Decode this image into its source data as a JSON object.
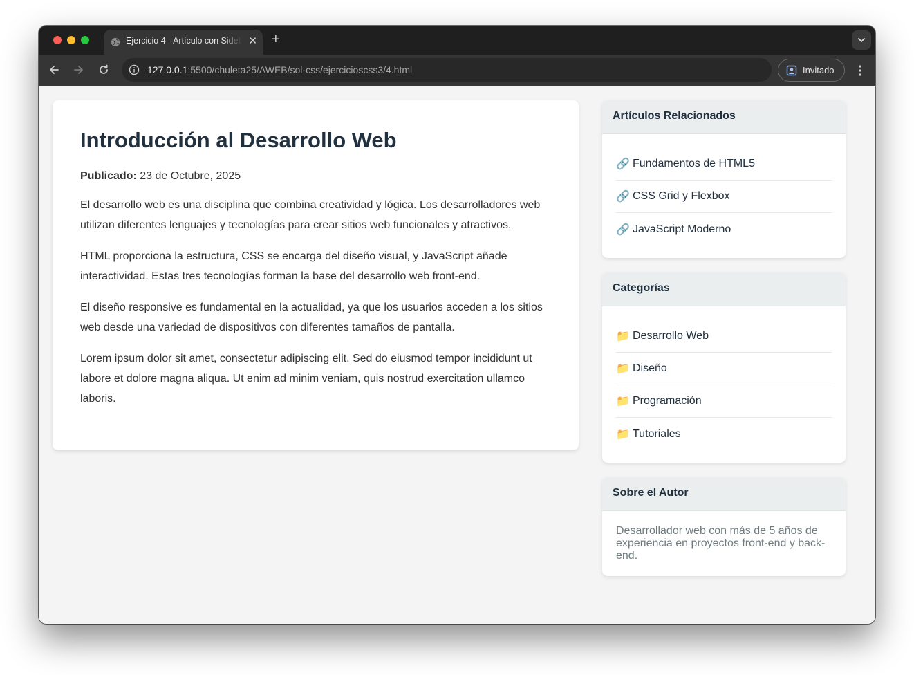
{
  "browser": {
    "tab_title": "Ejercicio 4 - Artículo con Sidebar",
    "tab_close": "✕",
    "new_tab": "+",
    "url_host": "127.0.0.1",
    "url_path": ":5500/chuleta25/AWEB/sol-css/ejercicioscss3/4.html",
    "profile_label": "Invitado"
  },
  "article": {
    "title": "Introducción al Desarrollo Web",
    "published_label": "Publicado:",
    "published_date": " 23 de Octubre, 2025",
    "paragraphs": [
      "El desarrollo web es una disciplina que combina creatividad y lógica. Los desarrolladores web utilizan diferentes lenguajes y tecnologías para crear sitios web funcionales y atractivos.",
      "HTML proporciona la estructura, CSS se encarga del diseño visual, y JavaScript añade interactividad. Estas tres tecnologías forman la base del desarrollo web front-end.",
      "El diseño responsive es fundamental en la actualidad, ya que los usuarios acceden a los sitios web desde una variedad de dispositivos con diferentes tamaños de pantalla.",
      "Lorem ipsum dolor sit amet, consectetur adipiscing elit. Sed do eiusmod tempor incididunt ut labore et dolore magna aliqua. Ut enim ad minim veniam, quis nostrud exercitation ullamco laboris."
    ]
  },
  "sidebar": {
    "related": {
      "title": "Artículos Relacionados",
      "icon": "🔗",
      "items": [
        "Fundamentos de HTML5",
        "CSS Grid y Flexbox",
        "JavaScript Moderno"
      ]
    },
    "categories": {
      "title": "Categorías",
      "icon": "📁",
      "items": [
        "Desarrollo Web",
        "Diseño",
        "Programación",
        "Tutoriales"
      ]
    },
    "author": {
      "title": "Sobre el Autor",
      "text": "Desarrollador web con más de 5 años de experiencia en proyectos front-end y back-end."
    }
  }
}
